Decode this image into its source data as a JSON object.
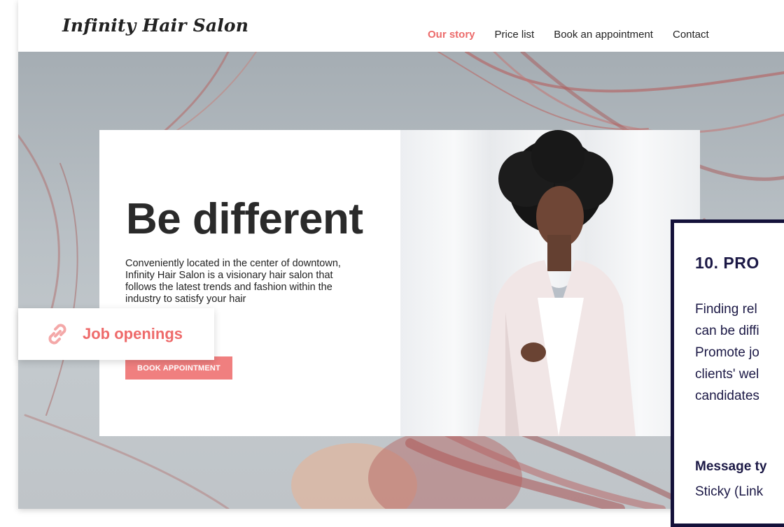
{
  "site": {
    "logo": "Infinity Hair Salon",
    "nav": [
      {
        "label": "Our story",
        "active": true
      },
      {
        "label": "Price list",
        "active": false
      },
      {
        "label": "Book an appointment",
        "active": false
      },
      {
        "label": "Contact",
        "active": false
      }
    ]
  },
  "hero": {
    "headline": "Be different",
    "intro": "Conveniently located in the center of downtown, Infinity Hair Salon is a visionary hair salon that follows the latest trends and fashion within the industry to satisfy your hair",
    "button_label": "BOOK APPOINTMENT"
  },
  "sticky": {
    "label": "Job openings",
    "icon": "link-icon"
  },
  "promo": {
    "title": "10. PRO",
    "body_lines": [
      "Finding rel",
      "can be diffi",
      "Promote jo",
      "clients' wel",
      "candidates"
    ],
    "message_type_label": "Message ty",
    "message_type_value": "Sticky (Link"
  },
  "colors": {
    "accent": "#ee6a6a",
    "button": "#f07f7f",
    "navy": "#14113a",
    "text_dark": "#222222"
  }
}
